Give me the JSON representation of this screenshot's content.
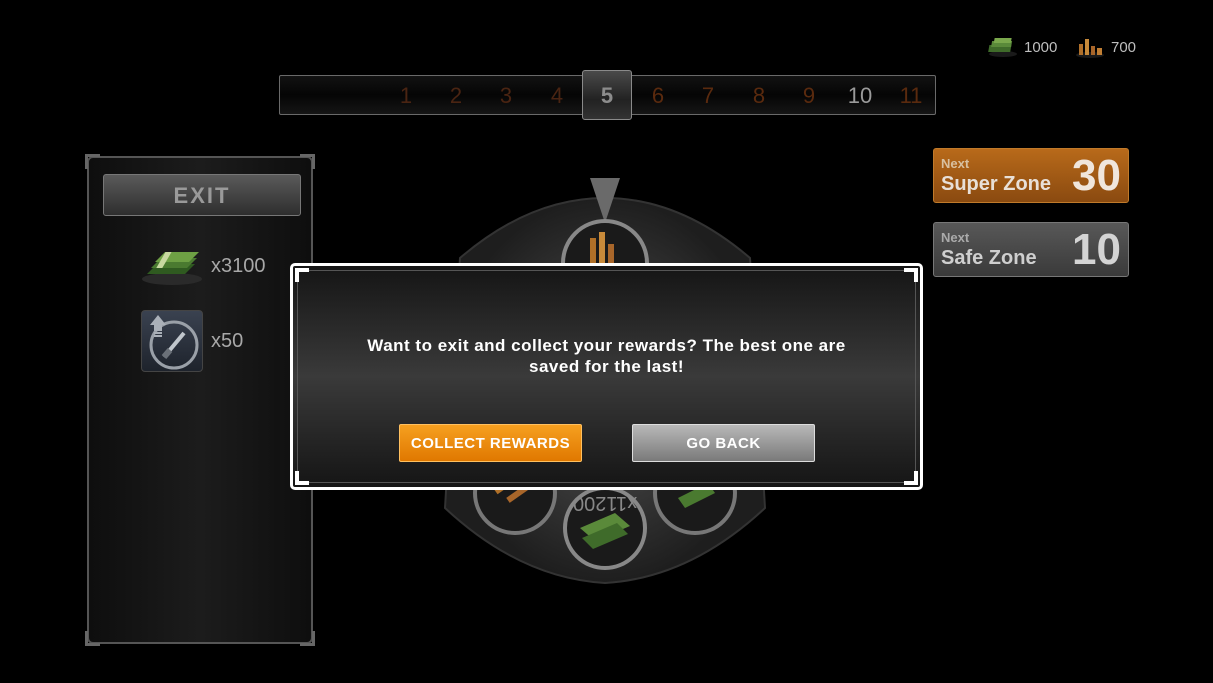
{
  "currency": {
    "cash_icon": "cash-stack-icon",
    "cash_amount": "1000",
    "gold_icon": "gold-bars-icon",
    "gold_amount": "700"
  },
  "zone_bar": {
    "numbers": [
      "1",
      "2",
      "3",
      "4",
      "5",
      "6",
      "7",
      "8",
      "9",
      "10",
      "11"
    ],
    "current": "5"
  },
  "left_panel": {
    "exit_label": "EXIT",
    "rewards": [
      {
        "icon": "cash-stack-icon",
        "count": "x3100"
      },
      {
        "icon": "knife-upgrade-icon",
        "count": "x50"
      }
    ]
  },
  "zones": {
    "super": {
      "next_label": "Next",
      "name": "Super Zone",
      "number": "30"
    },
    "safe": {
      "next_label": "Next",
      "name": "Safe Zone",
      "number": "10"
    }
  },
  "wheel": {
    "visible_label": "x11200"
  },
  "dialog": {
    "message": "Want to exit and collect your rewards? The best one are saved for the last!",
    "collect_label": "COLLECT REWARDS",
    "back_label": "GO BACK"
  },
  "colors": {
    "accent_orange": "#f09010",
    "super_zone": "#b86a1a",
    "safe_zone": "#585858"
  }
}
